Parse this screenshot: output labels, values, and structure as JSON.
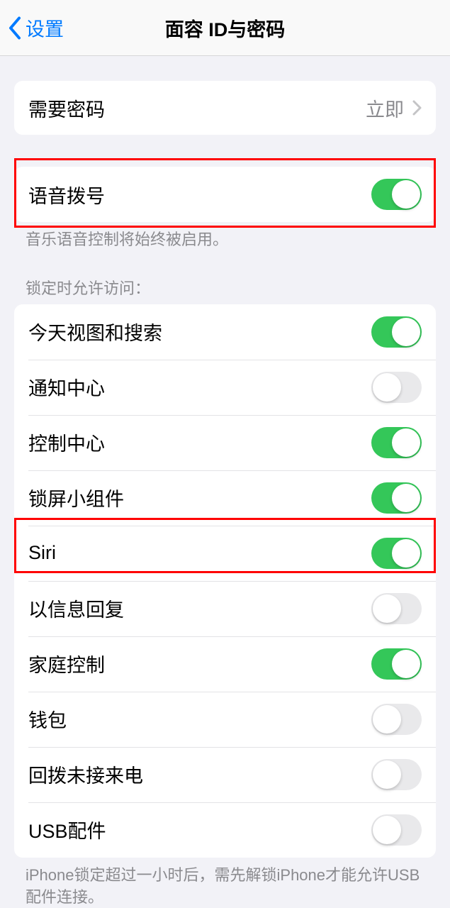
{
  "header": {
    "back_label": "设置",
    "title": "面容 ID与密码"
  },
  "require_passcode": {
    "label": "需要密码",
    "value": "立即"
  },
  "voice_dial": {
    "label": "语音拨号",
    "footer": "音乐语音控制将始终被启用。"
  },
  "lock_access": {
    "header": "锁定时允许访问：",
    "items": [
      {
        "label": "今天视图和搜索",
        "on": true
      },
      {
        "label": "通知中心",
        "on": false
      },
      {
        "label": "控制中心",
        "on": true
      },
      {
        "label": "锁屏小组件",
        "on": true
      },
      {
        "label": "Siri",
        "on": true
      },
      {
        "label": "以信息回复",
        "on": false
      },
      {
        "label": "家庭控制",
        "on": true
      },
      {
        "label": "钱包",
        "on": false
      },
      {
        "label": "回拨未接来电",
        "on": false
      },
      {
        "label": "USB配件",
        "on": false
      }
    ],
    "footer": "iPhone锁定超过一小时后，需先解锁iPhone才能允许USB配件连接。"
  }
}
